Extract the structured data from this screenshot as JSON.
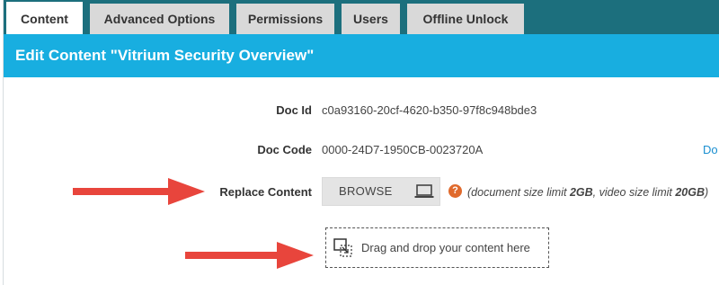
{
  "tabs": [
    {
      "label": "Content",
      "active": true
    },
    {
      "label": "Advanced Options",
      "active": false
    },
    {
      "label": "Permissions",
      "active": false
    },
    {
      "label": "Users",
      "active": false
    },
    {
      "label": "Offline Unlock",
      "active": false
    }
  ],
  "header": {
    "title": "Edit Content \"Vitrium Security Overview\""
  },
  "fields": {
    "doc_id": {
      "label": "Doc Id",
      "value": "c0a93160-20cf-4620-b350-97f8c948bde3"
    },
    "doc_code": {
      "label": "Doc Code",
      "value": "0000-24D7-1950CB-0023720A",
      "edge_link": "Do"
    },
    "replace": {
      "label": "Replace Content",
      "browse_label": "BROWSE"
    }
  },
  "limits": {
    "prefix": "(document size limit ",
    "doc_limit": "2GB",
    "middle": ", video size limit ",
    "video_limit": "20GB",
    "suffix": ")"
  },
  "dropzone": {
    "text": "Drag and drop your content here"
  },
  "icons": {
    "browse": "laptop-icon",
    "help": "help-icon",
    "drop": "drag-drop-icon",
    "annotation": "red-arrow"
  },
  "colors": {
    "tabbar_bg": "#1c6f7d",
    "header_bg": "#18aee0",
    "tab_bg": "#d9d9d9",
    "help_icon": "#e06a2c",
    "arrow": "#e8453c",
    "link": "#1a8fd0"
  }
}
